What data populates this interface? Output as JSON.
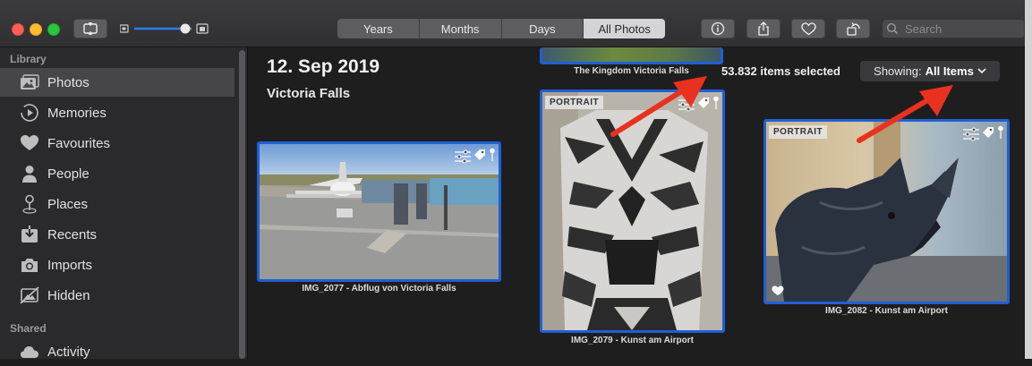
{
  "toolbar": {
    "segments": [
      "Years",
      "Months",
      "Days",
      "All Photos"
    ],
    "active_segment": "All Photos",
    "search_placeholder": "Search",
    "zoom_level": 0.75
  },
  "sidebar": {
    "library_label": "Library",
    "items": [
      {
        "label": "Photos",
        "icon": "photos-icon",
        "selected": true
      },
      {
        "label": "Memories",
        "icon": "memories-icon"
      },
      {
        "label": "Favourites",
        "icon": "heart-icon"
      },
      {
        "label": "People",
        "icon": "person-icon"
      },
      {
        "label": "Places",
        "icon": "pin-icon"
      },
      {
        "label": "Recents",
        "icon": "recents-icon"
      },
      {
        "label": "Imports",
        "icon": "camera-icon"
      },
      {
        "label": "Hidden",
        "icon": "hidden-icon"
      }
    ],
    "shared_label": "Shared",
    "shared_items": [
      {
        "label": "Activity",
        "icon": "cloud-icon"
      }
    ]
  },
  "main": {
    "date": "12. Sep 2019",
    "place": "Victoria Falls",
    "selection_count": "53.832 items selected",
    "showing_prefix": "Showing:",
    "showing_value": "All Items",
    "photos": [
      {
        "caption": "The Kingdom Victoria Falls"
      },
      {
        "caption": "IMG_2077 - Abflug von Victoria Falls"
      },
      {
        "caption": "IMG_2079 - Kunst am Airport",
        "badge": "PORTRAIT"
      },
      {
        "caption": "IMG_2082 - Kunst am Airport",
        "badge": "PORTRAIT",
        "favourite": true
      }
    ]
  },
  "colors": {
    "selection_border": "#1f5fd6",
    "annotation_arrow": "#e8321f",
    "sidebar_bg": "#2a2a2c",
    "content_bg": "#1e1e1e"
  }
}
